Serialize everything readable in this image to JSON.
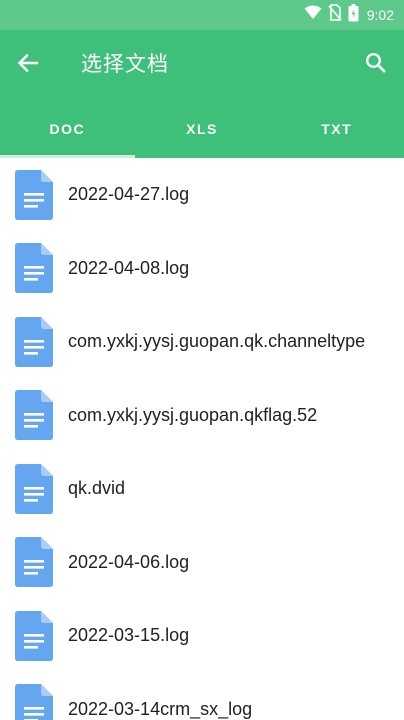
{
  "status_bar": {
    "time": "9:02",
    "icons": [
      "wifi-icon",
      "no-sim-icon",
      "battery-icon"
    ]
  },
  "toolbar": {
    "back_icon": "arrow-left-icon",
    "title": "选择文档",
    "search_icon": "search-icon"
  },
  "tabs": [
    {
      "label": "DOC",
      "selected": true
    },
    {
      "label": "XLS",
      "selected": false
    },
    {
      "label": "TXT",
      "selected": false
    }
  ],
  "files": [
    {
      "name": "2022-04-27.log",
      "icon": "document-icon"
    },
    {
      "name": "2022-04-08.log",
      "icon": "document-icon"
    },
    {
      "name": "com.yxkj.yysj.guopan.qk.channeltype",
      "icon": "document-icon"
    },
    {
      "name": "com.yxkj.yysj.guopan.qkflag.52",
      "icon": "document-icon"
    },
    {
      "name": "qk.dvid",
      "icon": "document-icon"
    },
    {
      "name": "2022-04-06.log",
      "icon": "document-icon"
    },
    {
      "name": "2022-03-15.log",
      "icon": "document-icon"
    },
    {
      "name": "2022-03-14crm_sx_log",
      "icon": "document-icon"
    }
  ],
  "colors": {
    "toolbar": "#3fc07a",
    "status_bar": "#5ec98b",
    "doc_icon": "#64a6f0",
    "doc_icon_fold": "#a9cdf7"
  }
}
